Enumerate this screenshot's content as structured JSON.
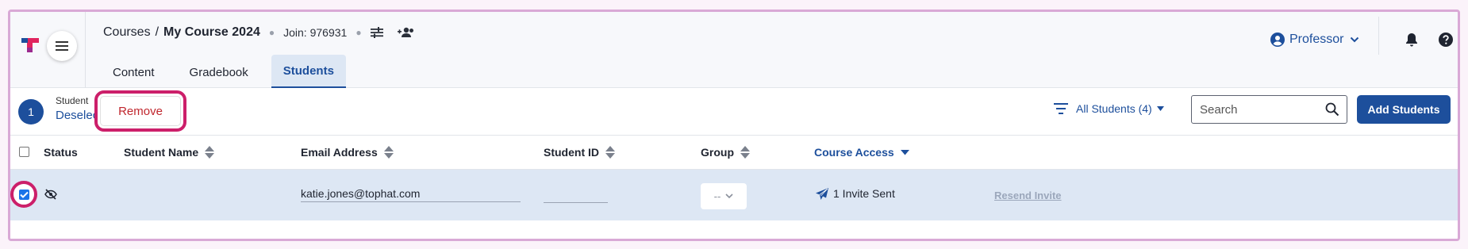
{
  "header": {
    "breadcrumb": {
      "parent": "Courses",
      "separator": "/",
      "current": "My Course 2024"
    },
    "join_code": "Join: 976931",
    "icons": [
      "sliders-icon",
      "add-group-icon"
    ],
    "tabs": [
      {
        "label": "Content",
        "active": false
      },
      {
        "label": "Gradebook",
        "active": false
      },
      {
        "label": "Students",
        "active": true
      }
    ],
    "profile_label": "Professor"
  },
  "toolbar": {
    "selected_count": "1",
    "selected_label": "Student",
    "deselect_label": "Deselect",
    "remove_label": "Remove",
    "filter_label": "All Students (4)",
    "search_placeholder": "Search",
    "add_label": "Add Students"
  },
  "table": {
    "columns": [
      "Status",
      "Student Name",
      "Email Address",
      "Student ID",
      "Group",
      "Course Access"
    ],
    "rows": [
      {
        "selected": true,
        "status_icon": "invisible-icon",
        "student_name": "",
        "email": "katie.jones@tophat.com",
        "student_id": "",
        "group": "--",
        "course_access": "1 Invite Sent",
        "action": "Resend Invite"
      }
    ]
  },
  "colors": {
    "accent": "#1d4f9c",
    "highlight_ring": "#cc1f6a",
    "selected_row": "#dde7f4",
    "remove_text": "#c0262d"
  }
}
